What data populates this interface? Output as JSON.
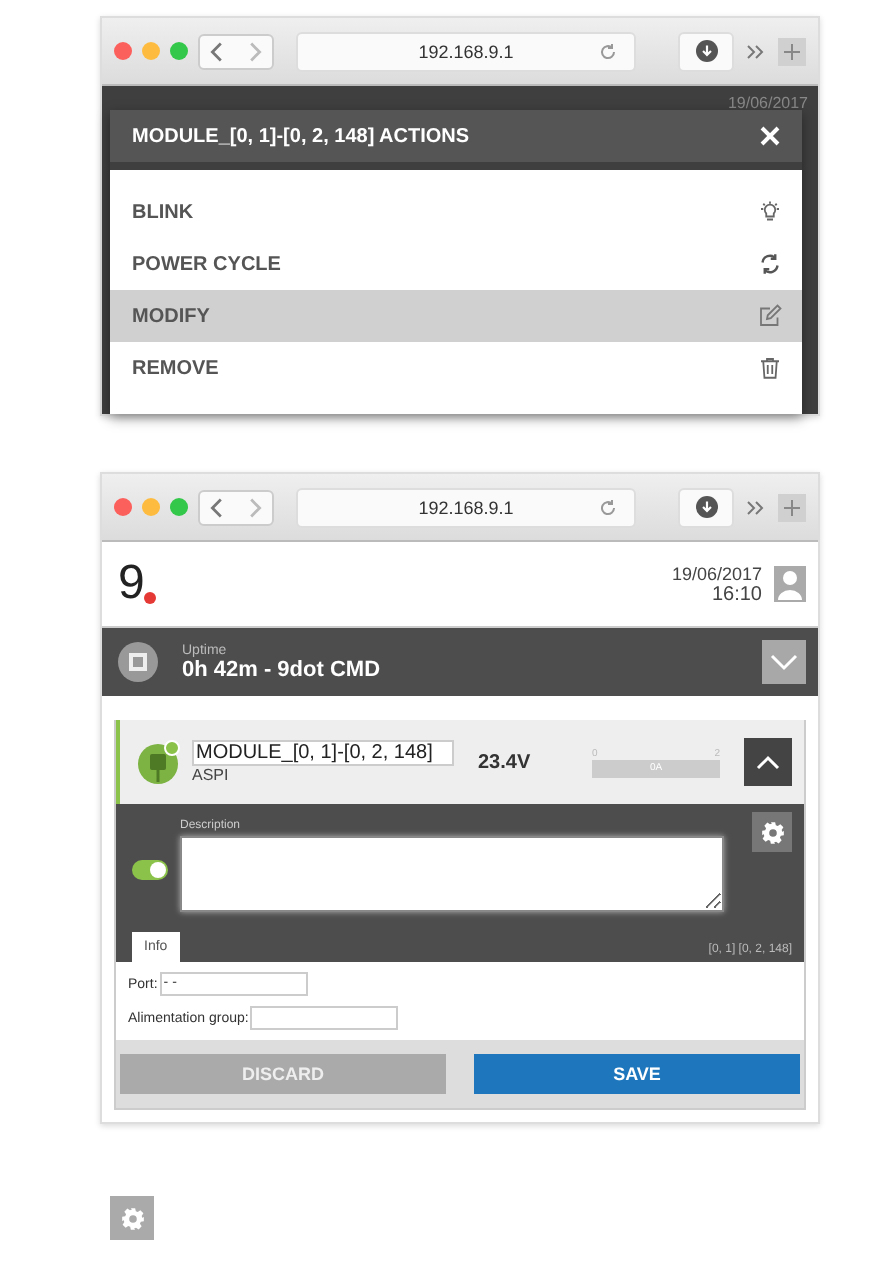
{
  "actions_window": {
    "url": "192.168.9.1",
    "backdrop": {
      "date": "19/06/2017"
    },
    "dialog": {
      "title": "MODULE_[0, 1]-[0, 2, 148] ACTIONS",
      "actions": [
        {
          "label": "BLINK",
          "kind": "blink",
          "selected": false
        },
        {
          "label": "POWER CYCLE",
          "kind": "power",
          "selected": false
        },
        {
          "label": "MODIFY",
          "kind": "modify",
          "selected": true
        },
        {
          "label": "REMOVE",
          "kind": "remove",
          "selected": false
        }
      ]
    }
  },
  "module_window": {
    "url": "192.168.9.1",
    "header": {
      "logo": "9",
      "date": "19/06/2017",
      "time": "16:10"
    },
    "uptime": {
      "label": "Uptime",
      "value": "0h 42m - 9dot CMD"
    },
    "module": {
      "name": "MODULE_[0, 1]-[0, 2, 148]",
      "type": "ASPI",
      "voltage": "23.4V",
      "expanded": true,
      "meter": {
        "min": "0",
        "max": "2",
        "reading": "0A",
        "level": 0
      },
      "enabled": true,
      "description_label": "Description",
      "tabs": [
        {
          "label": "Info",
          "selected": true
        }
      ],
      "address": "[0, 1] [0, 2, 148]",
      "fields": [
        {
          "label": "Port:",
          "value": "- -"
        },
        {
          "label": "Alimentation group:"
        }
      ],
      "buttons": [
        {
          "label": "DISCARD",
          "kind": "secondary"
        },
        {
          "label": "SAVE",
          "kind": "primary"
        }
      ]
    }
  }
}
